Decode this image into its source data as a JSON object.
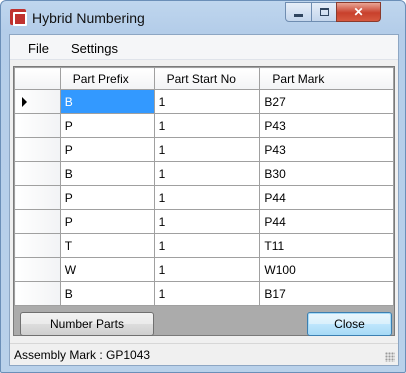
{
  "window": {
    "title": "Hybrid Numbering",
    "app_icon": "hybrid-numbering-app-icon",
    "caption_buttons": [
      "minimize-icon",
      "maximize-icon",
      "close-icon"
    ],
    "close_glyph": "✕"
  },
  "menu": {
    "items": [
      {
        "label": "File"
      },
      {
        "label": "Settings"
      }
    ]
  },
  "grid": {
    "columns": [
      "Part Prefix",
      "Part Start No",
      "Part Mark"
    ],
    "current_row_indicator": "triangle-arrow-icon",
    "selected_cell": {
      "row": 0,
      "column": "Part Prefix"
    },
    "selection_color": "#3399ff",
    "rows": [
      {
        "prefix": "B",
        "start_no": "1",
        "mark": "B27"
      },
      {
        "prefix": "P",
        "start_no": "1",
        "mark": "P43"
      },
      {
        "prefix": "P",
        "start_no": "1",
        "mark": "P43"
      },
      {
        "prefix": "B",
        "start_no": "1",
        "mark": "B30"
      },
      {
        "prefix": "P",
        "start_no": "1",
        "mark": "P44"
      },
      {
        "prefix": "P",
        "start_no": "1",
        "mark": "P44"
      },
      {
        "prefix": "T",
        "start_no": "1",
        "mark": "T11"
      },
      {
        "prefix": "W",
        "start_no": "1",
        "mark": "W100"
      },
      {
        "prefix": "B",
        "start_no": "1",
        "mark": "B17"
      }
    ]
  },
  "buttons": {
    "number_parts": "Number Parts",
    "close": "Close"
  },
  "status": {
    "text": "Assembly Mark : GP1043"
  }
}
